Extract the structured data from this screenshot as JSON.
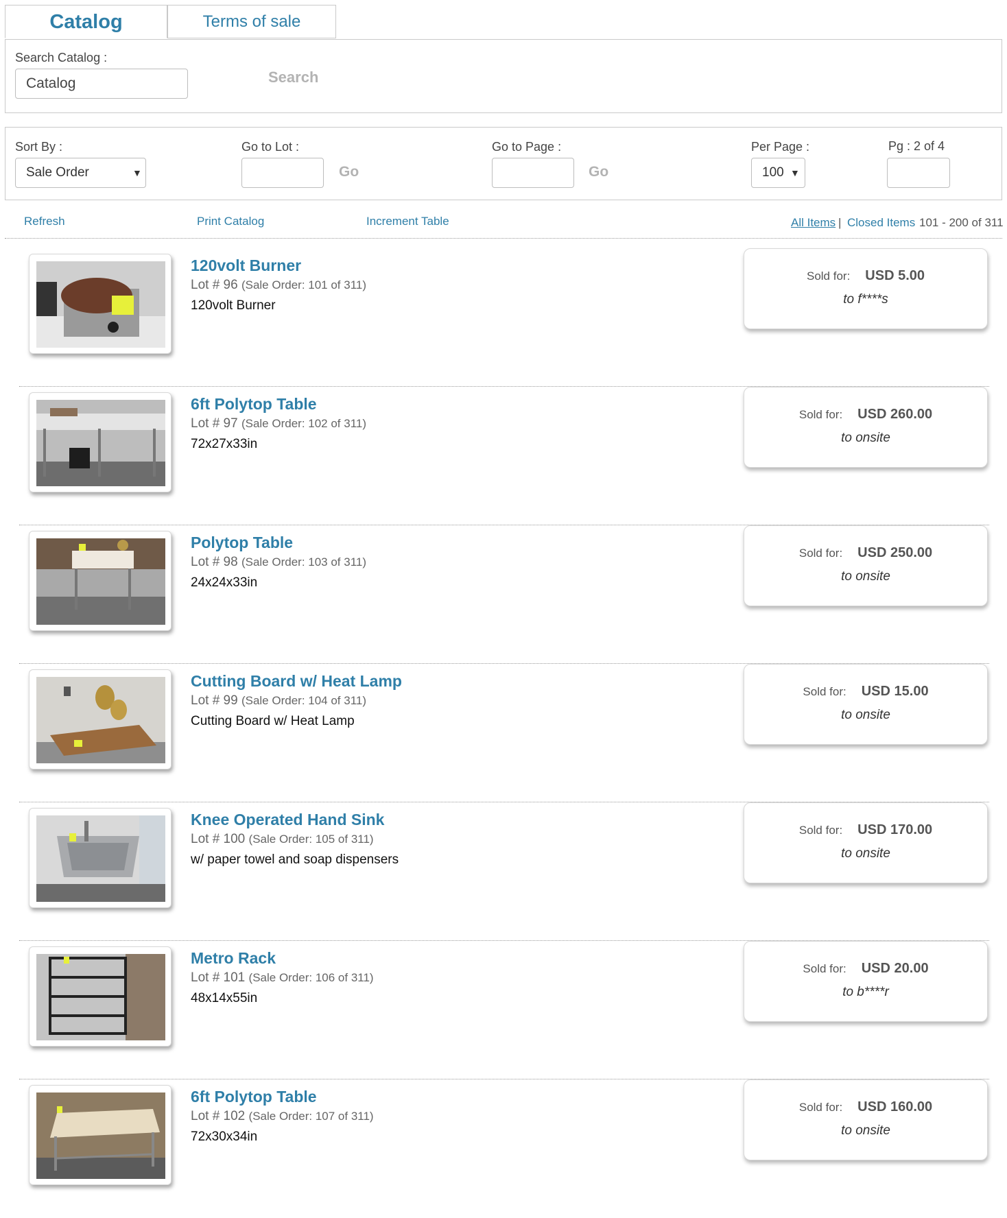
{
  "tabs": {
    "catalog": "Catalog",
    "terms": "Terms of sale"
  },
  "search": {
    "label": "Search Catalog :",
    "value": "Catalog",
    "button": "Search"
  },
  "filters": {
    "sort_label": "Sort By :",
    "sort_value": "Sale Order",
    "goto_lot_label": "Go to Lot :",
    "goto_lot_button": "Go",
    "goto_page_label": "Go to Page :",
    "goto_page_button": "Go",
    "per_page_label": "Per Page :",
    "per_page_value": "100",
    "page_indicator": "Pg : 2 of 4"
  },
  "toolbar": {
    "refresh": "Refresh",
    "print": "Print Catalog",
    "increment": "Increment Table",
    "all_items": "All Items",
    "separator": "|",
    "closed_items": "Closed Items",
    "range": "101 - 200 of 311"
  },
  "sold_label": "Sold for:",
  "items": [
    {
      "title": "120volt Burner",
      "lot": "Lot # 96",
      "sale_order": "(Sale Order: 101 of 311)",
      "desc": "120volt Burner",
      "price": "USD 5.00",
      "buyer": "to f****s"
    },
    {
      "title": "6ft Polytop Table",
      "lot": "Lot # 97",
      "sale_order": "(Sale Order: 102 of 311)",
      "desc": "72x27x33in",
      "price": "USD 260.00",
      "buyer": "to onsite"
    },
    {
      "title": "Polytop Table",
      "lot": "Lot # 98",
      "sale_order": "(Sale Order: 103 of 311)",
      "desc": "24x24x33in",
      "price": "USD 250.00",
      "buyer": "to onsite"
    },
    {
      "title": "Cutting Board w/ Heat Lamp",
      "lot": "Lot # 99",
      "sale_order": "(Sale Order: 104 of 311)",
      "desc": "Cutting Board w/ Heat Lamp",
      "price": "USD 15.00",
      "buyer": "to onsite"
    },
    {
      "title": "Knee Operated Hand Sink",
      "lot": "Lot # 100",
      "sale_order": "(Sale Order: 105 of 311)",
      "desc": "w/ paper towel and soap dispensers",
      "price": "USD 170.00",
      "buyer": "to onsite"
    },
    {
      "title": "Metro Rack",
      "lot": "Lot # 101",
      "sale_order": "(Sale Order: 106 of 311)",
      "desc": "48x14x55in",
      "price": "USD 20.00",
      "buyer": "to b****r"
    },
    {
      "title": "6ft Polytop Table",
      "lot": "Lot # 102",
      "sale_order": "(Sale Order: 107 of 311)",
      "desc": "72x30x34in",
      "price": "USD 160.00",
      "buyer": "to onsite"
    }
  ]
}
